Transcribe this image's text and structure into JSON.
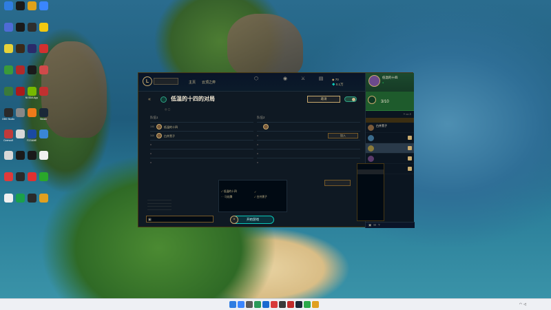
{
  "desktop": {
    "icons": [
      {
        "label": "",
        "color": "#2f7de1"
      },
      {
        "label": "",
        "color": "#1a1a1a"
      },
      {
        "label": "",
        "color": "#e0a21a"
      },
      {
        "label": "",
        "color": "#3a86ff"
      },
      {
        "label": "",
        "color": "#4e6bd6"
      },
      {
        "label": "",
        "color": "#1a1a1a"
      },
      {
        "label": "",
        "color": "#2e2e2e"
      },
      {
        "label": "",
        "color": "#f2c811"
      },
      {
        "label": "",
        "color": "#e6d23a"
      },
      {
        "label": "",
        "color": "#3a2a1a"
      },
      {
        "label": "",
        "color": "#2a2a6a"
      },
      {
        "label": "",
        "color": "#d23030"
      },
      {
        "label": "",
        "color": "#3a9a3a"
      },
      {
        "label": "",
        "color": "#b02a2a"
      },
      {
        "label": "",
        "color": "#1a1a1a"
      },
      {
        "label": "",
        "color": "#d04a4a"
      },
      {
        "label": "",
        "color": "#3a7a3a"
      },
      {
        "label": "",
        "color": "#aa1a1a"
      },
      {
        "label": "NVIDIA App",
        "color": "#76b900"
      },
      {
        "label": "",
        "color": "#c03030"
      },
      {
        "label": "OBS Studio",
        "color": "#2a2a2a"
      },
      {
        "label": "",
        "color": "#888888"
      },
      {
        "label": "",
        "color": "#ee7a1a"
      },
      {
        "label": "Steam",
        "color": "#1b2838"
      },
      {
        "label": "Overwolf",
        "color": "#c03a3a"
      },
      {
        "label": "",
        "color": "#d8d8d8"
      },
      {
        "label": "TCGAME",
        "color": "#1a4aa0"
      },
      {
        "label": "",
        "color": "#3a86d6"
      },
      {
        "label": "",
        "color": "#d8d8d8"
      },
      {
        "label": "",
        "color": "#1a1a1a"
      },
      {
        "label": "",
        "color": "#1a1a1a"
      },
      {
        "label": "",
        "color": "#f0f0f0"
      },
      {
        "label": "",
        "color": "#e03a3a"
      },
      {
        "label": "",
        "color": "#2a2a2a"
      },
      {
        "label": "",
        "color": "#e03030"
      },
      {
        "label": "",
        "color": "#2aa82a"
      },
      {
        "label": "",
        "color": "#f0f0f0"
      },
      {
        "label": "",
        "color": "#1aa04a"
      },
      {
        "label": "",
        "color": "#2a2a2a"
      },
      {
        "label": "",
        "color": "#e0a020"
      }
    ]
  },
  "client": {
    "nav": {
      "home": "主页",
      "tft": "云顶之弈"
    },
    "top_icons": [
      {
        "label": "",
        "glyph": "⬡"
      },
      {
        "label": "",
        "glyph": "◉"
      },
      {
        "label": "",
        "glyph": "⚔"
      },
      {
        "label": "",
        "glyph": "▤"
      }
    ],
    "currency": {
      "be": "70",
      "rp": "0.1万"
    },
    "lobby": {
      "title": "低温的十四的对局",
      "subtitle": "",
      "invite": "邀请",
      "team1": {
        "header": "队伍1",
        "slots": [
          {
            "level": "190",
            "name": "低温的十四",
            "rank": "",
            "position": ""
          },
          {
            "level": "340",
            "name": "白井黑子",
            "rank": "",
            "position": ""
          }
        ]
      },
      "team2": {
        "header": "队伍2",
        "slots": [
          {
            "level": "",
            "name": "",
            "rank": "",
            "position": ""
          },
          {
            "join": "加入"
          }
        ]
      },
      "summary": {
        "header": "",
        "items": [
          "低温的十四",
          "",
          "白井黑子",
          "马化腾"
        ]
      },
      "prepare": "",
      "ready": "",
      "chat_input_placeholder": "",
      "start": "开始游戏"
    },
    "social": {
      "profile_name": "低温的十四",
      "mission_progress": "3/10",
      "header": "",
      "group": "",
      "friends": [
        {
          "name": "白井黑子",
          "status": ""
        },
        {
          "name": "",
          "status": ""
        },
        {
          "name": "",
          "status": ""
        },
        {
          "name": "",
          "status": ""
        },
        {
          "name": "",
          "status": ""
        }
      ],
      "version": ""
    },
    "context_menu": {
      "items": [
        "",
        "",
        "",
        "",
        "",
        "",
        "",
        "",
        "",
        "",
        ""
      ]
    }
  },
  "taskbar": {
    "time": "",
    "date": "",
    "apps": [
      {
        "color": "#3a86ff"
      },
      {
        "color": "#5a5a5a"
      },
      {
        "color": "#2a9a5a"
      },
      {
        "color": "#1a6ad0"
      },
      {
        "color": "#d83a3a"
      },
      {
        "color": "#3a3a3a"
      },
      {
        "color": "#c02a2a"
      },
      {
        "color": "#1b2838"
      },
      {
        "color": "#2aa84a"
      },
      {
        "color": "#e0a020"
      }
    ]
  }
}
